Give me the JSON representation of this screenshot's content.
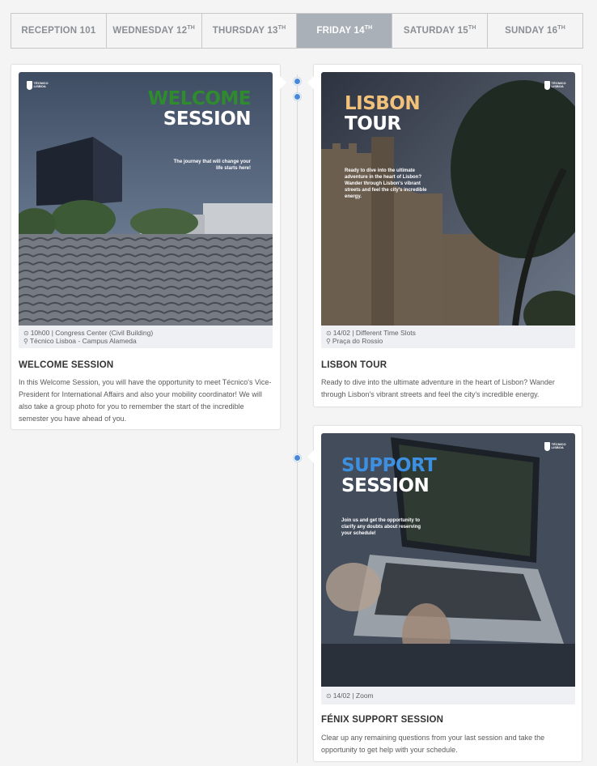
{
  "tabs": [
    {
      "label": "RECEPTION 101",
      "sup": "",
      "active": false
    },
    {
      "label": "WEDNESDAY 12",
      "sup": "TH",
      "active": false
    },
    {
      "label": "THURSDAY 13",
      "sup": "TH",
      "active": false
    },
    {
      "label": "FRIDAY 14",
      "sup": "TH",
      "active": true
    },
    {
      "label": "SATURDAY 15",
      "sup": "TH",
      "active": false
    },
    {
      "label": "SUNDAY 16",
      "sup": "TH",
      "active": false
    }
  ],
  "events": {
    "welcome": {
      "poster": {
        "logo_text": "TÉCNICO LISBOA",
        "title_line1": "WELCOME",
        "title_line2": "SESSION",
        "subtitle": "The journey that will change your life starts here!"
      },
      "meta_line1": "10h00 | Congress Center (Civil Building)",
      "meta_line2": "Técnico Lisboa - Campus Alameda",
      "title": "WELCOME SESSION",
      "description": "In this Welcome Session, you will have the opportunity to meet Técnico's Vice-President for International Affairs and also your mobility coordinator! We will also take a group photo for you to remember the start of the incredible semester you have ahead of you."
    },
    "lisbon": {
      "poster": {
        "logo_text": "TÉCNICO LISBOA",
        "title_line1": "LISBON",
        "title_line2": "TOUR",
        "subtitle": "Ready to dive into the ultimate adventure in the heart of Lisbon? Wander through Lisbon's vibrant streets and feel the city's incredible energy."
      },
      "meta_line1": "14/02 | Different Time Slots",
      "meta_line2": "Praça do Rossio",
      "title": "LISBON TOUR",
      "description": "Ready to dive into the ultimate adventure in the heart of Lisbon? Wander through Lisbon's vibrant streets and feel the city's incredible energy."
    },
    "support": {
      "poster": {
        "logo_text": "TÉCNICO LISBOA",
        "title_line1": "SUPPORT",
        "title_line2": "SESSION",
        "subtitle": "Join us and get the opportunity to clarify any doubts about reserving your schedule!"
      },
      "meta_line1": "14/02 | Zoom",
      "title": "FÉNIX SUPPORT SESSION",
      "description": "Clear up any remaining questions from your last session and take the opportunity to get help with your schedule."
    }
  },
  "colors": {
    "active_tab": "#a9b0b8",
    "timeline_dot": "#4a88d8",
    "welcome_accent": "#2e8b2e",
    "lisbon_accent": "#f2c27a",
    "support_accent": "#3d8fe0"
  },
  "icons": {
    "clock": "clock-icon",
    "location": "location-pin-icon",
    "logo": "tecnico-logo"
  }
}
